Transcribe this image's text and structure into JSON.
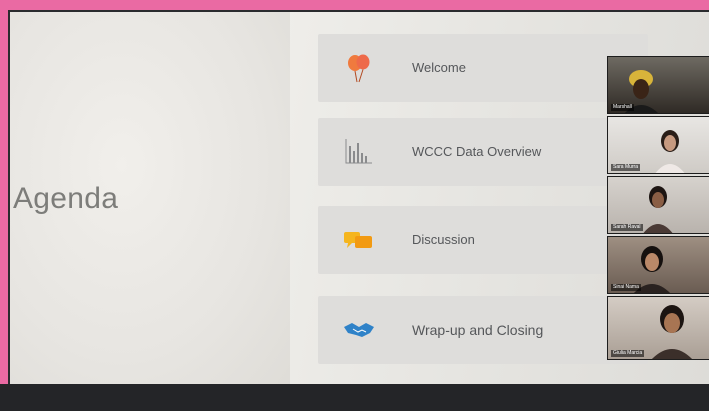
{
  "slide": {
    "title": "Agenda",
    "items": [
      {
        "label": "Welcome",
        "icon": "balloons-icon"
      },
      {
        "label": "WCCC Data Overview",
        "icon": "bar-chart-icon"
      },
      {
        "label": "Discussion",
        "icon": "chat-bubbles-icon"
      },
      {
        "label": "Wrap-up and Closing",
        "icon": "handshake-icon"
      }
    ]
  },
  "participants": [
    {
      "name": "Marshall"
    },
    {
      "name": "Sara Murra"
    },
    {
      "name": "Sarah Raval"
    },
    {
      "name": "Sinai Nama"
    },
    {
      "name": "Giulia Marcia"
    }
  ],
  "colors": {
    "frame": "#ea6aa3",
    "balloons": "#f07a3e",
    "chat": "#f5b51e",
    "handshake": "#2f82c8"
  }
}
